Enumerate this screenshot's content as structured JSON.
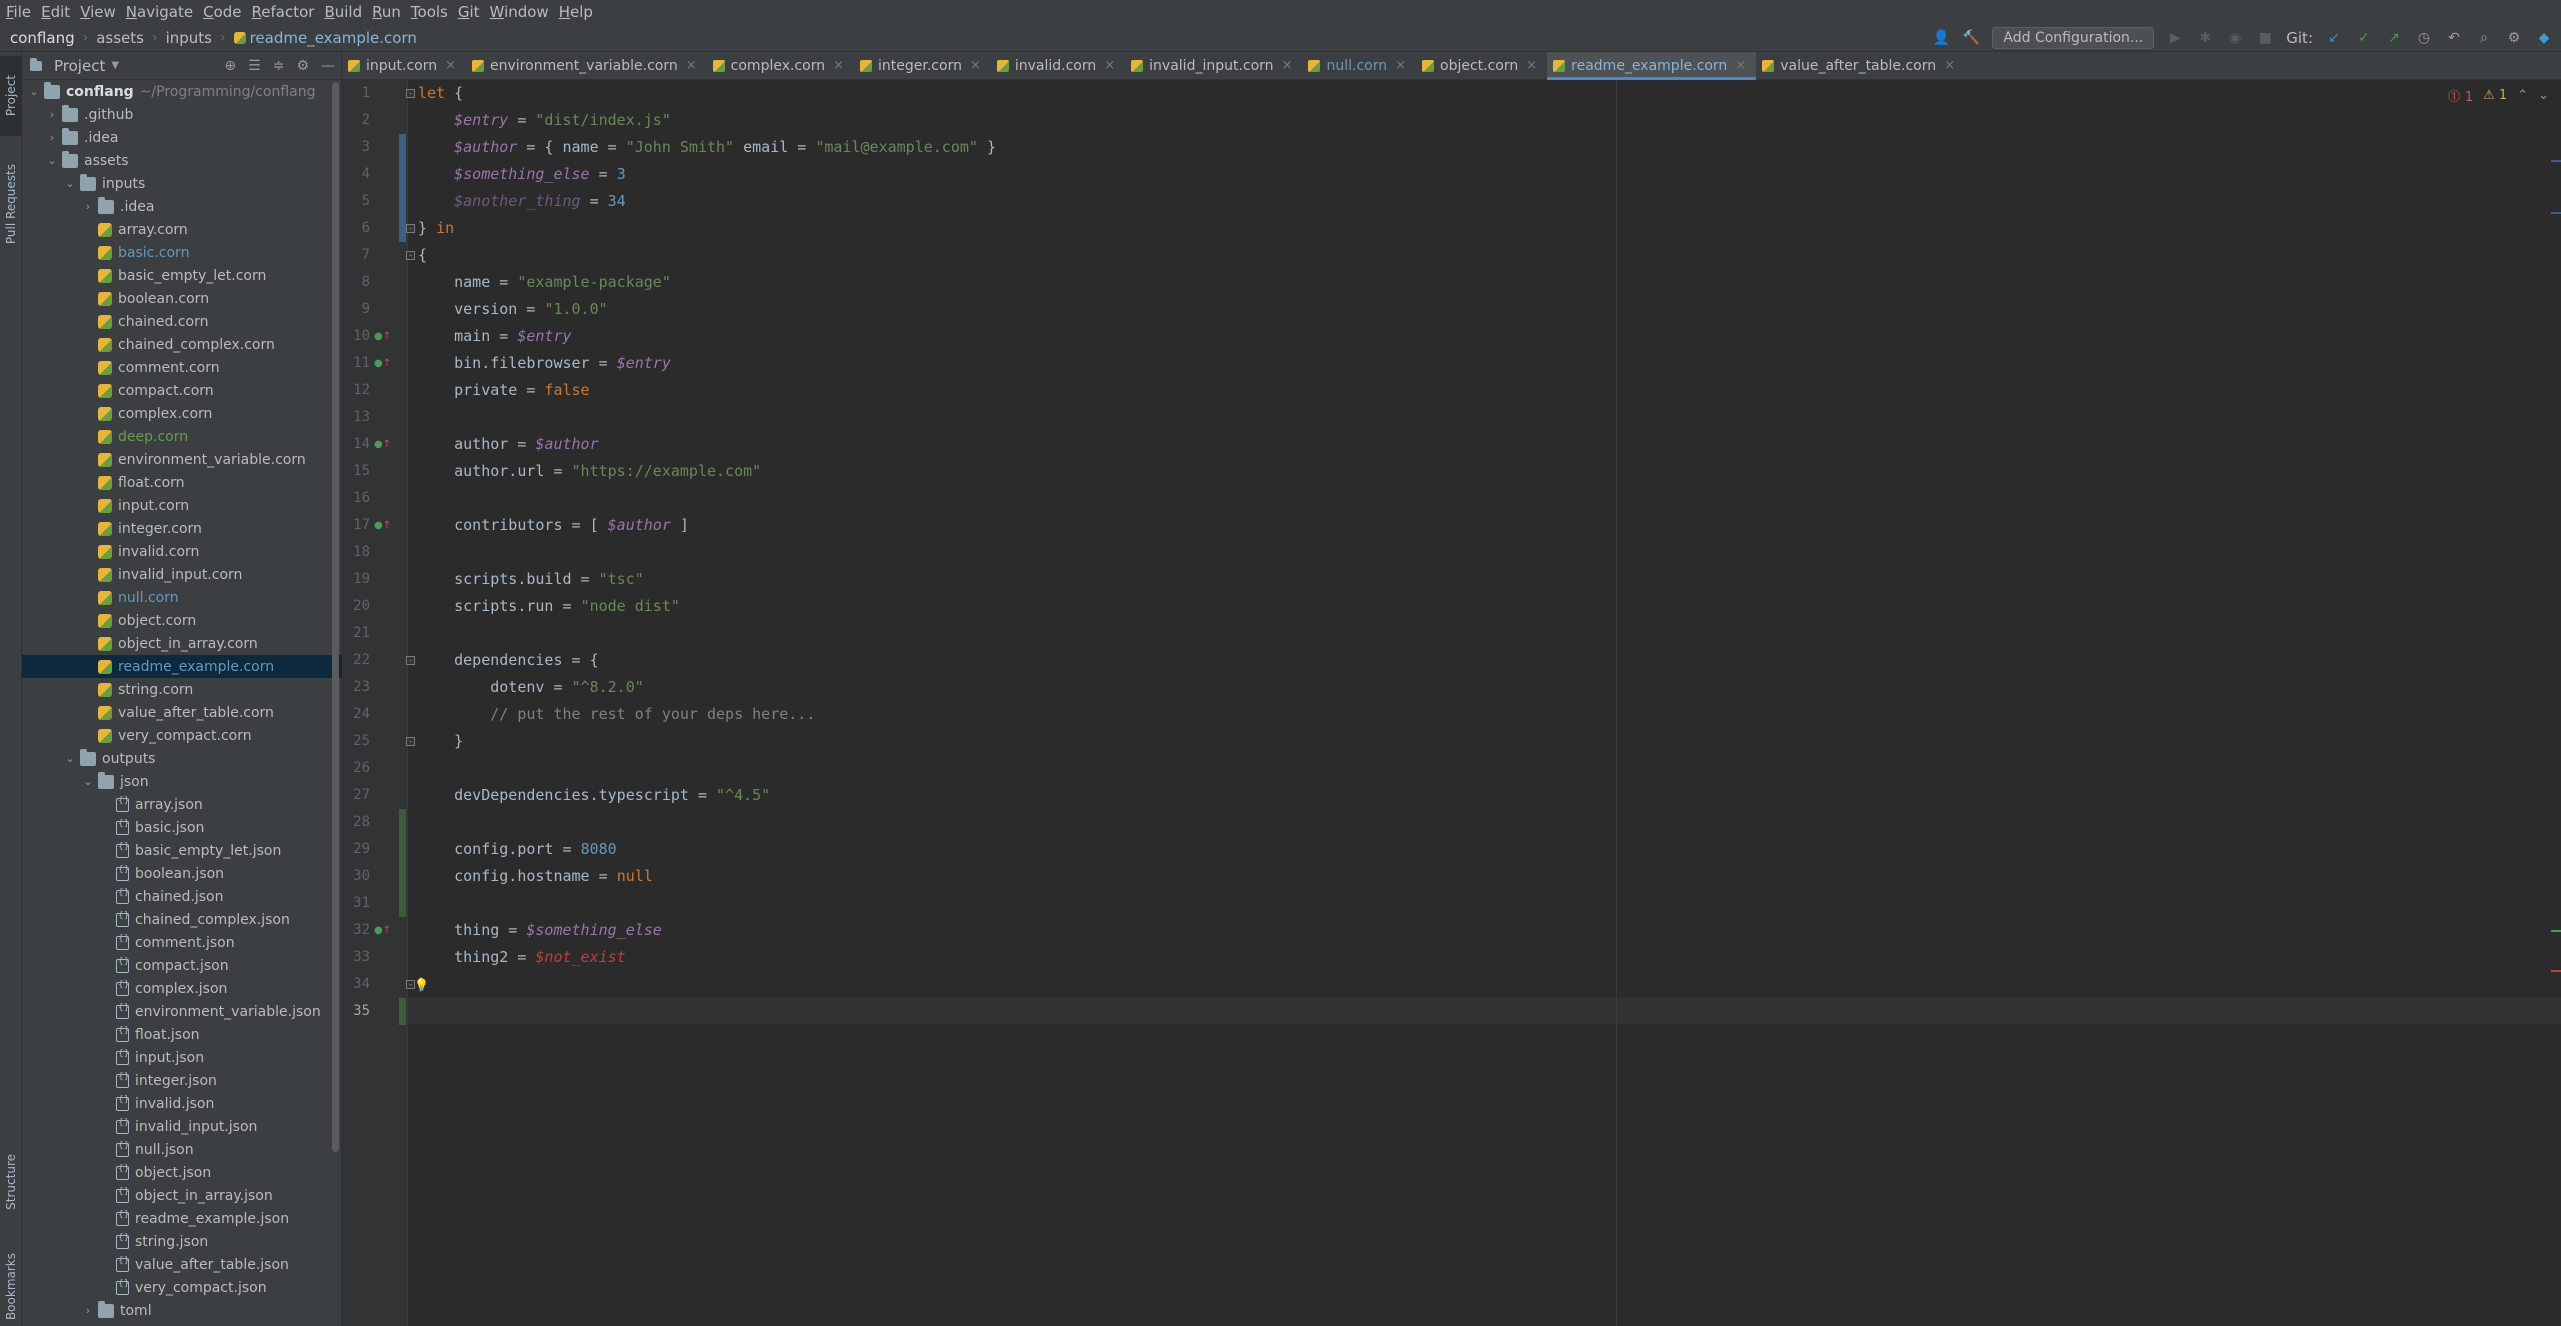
{
  "menu": [
    {
      "id": "file",
      "m": "F",
      "rest": "ile"
    },
    {
      "id": "edit",
      "m": "E",
      "rest": "dit"
    },
    {
      "id": "view",
      "m": "V",
      "rest": "iew"
    },
    {
      "id": "navigate",
      "m": "N",
      "rest": "avigate"
    },
    {
      "id": "code",
      "m": "C",
      "rest": "ode"
    },
    {
      "id": "refactor",
      "m": "R",
      "rest": "efactor"
    },
    {
      "id": "build",
      "m": "B",
      "rest": "uild"
    },
    {
      "id": "run",
      "m": "R",
      "rest": "un"
    },
    {
      "id": "tools",
      "m": "T",
      "rest": "ools"
    },
    {
      "id": "git",
      "m": "G",
      "rest": "it"
    },
    {
      "id": "window",
      "m": "W",
      "rest": "indow"
    },
    {
      "id": "help",
      "m": "H",
      "rest": "elp"
    }
  ],
  "breadcrumb": [
    "conflang",
    "assets",
    "inputs",
    "readme_example.corn"
  ],
  "toolbar": {
    "add_config": "Add Configuration...",
    "git_label": "Git:"
  },
  "left_strip": {
    "project": "Project",
    "pull_requests": "Pull Requests",
    "structure": "Structure",
    "bookmarks": "Bookmarks"
  },
  "project_panel": {
    "title": "Project",
    "tree": [
      {
        "depth": 0,
        "type": "folder",
        "open": true,
        "name": "conflang",
        "path": "~/Programming/conflang",
        "style": "root"
      },
      {
        "depth": 1,
        "type": "folder",
        "open": false,
        "name": ".github"
      },
      {
        "depth": 1,
        "type": "folder",
        "open": false,
        "name": ".idea"
      },
      {
        "depth": 1,
        "type": "folder",
        "open": true,
        "name": "assets"
      },
      {
        "depth": 2,
        "type": "folder",
        "open": true,
        "name": "inputs"
      },
      {
        "depth": 3,
        "type": "folder",
        "open": false,
        "name": ".idea"
      },
      {
        "depth": 3,
        "type": "corn",
        "name": "array.corn"
      },
      {
        "depth": 3,
        "type": "corn",
        "name": "basic.corn",
        "style": "blue"
      },
      {
        "depth": 3,
        "type": "corn",
        "name": "basic_empty_let.corn"
      },
      {
        "depth": 3,
        "type": "corn",
        "name": "boolean.corn"
      },
      {
        "depth": 3,
        "type": "corn",
        "name": "chained.corn"
      },
      {
        "depth": 3,
        "type": "corn",
        "name": "chained_complex.corn"
      },
      {
        "depth": 3,
        "type": "corn",
        "name": "comment.corn"
      },
      {
        "depth": 3,
        "type": "corn",
        "name": "compact.corn"
      },
      {
        "depth": 3,
        "type": "corn",
        "name": "complex.corn"
      },
      {
        "depth": 3,
        "type": "corn",
        "name": "deep.corn",
        "style": "green"
      },
      {
        "depth": 3,
        "type": "corn",
        "name": "environment_variable.corn"
      },
      {
        "depth": 3,
        "type": "corn",
        "name": "float.corn"
      },
      {
        "depth": 3,
        "type": "corn",
        "name": "input.corn"
      },
      {
        "depth": 3,
        "type": "corn",
        "name": "integer.corn"
      },
      {
        "depth": 3,
        "type": "corn",
        "name": "invalid.corn"
      },
      {
        "depth": 3,
        "type": "corn",
        "name": "invalid_input.corn"
      },
      {
        "depth": 3,
        "type": "corn",
        "name": "null.corn",
        "style": "blue"
      },
      {
        "depth": 3,
        "type": "corn",
        "name": "object.corn"
      },
      {
        "depth": 3,
        "type": "corn",
        "name": "object_in_array.corn"
      },
      {
        "depth": 3,
        "type": "corn",
        "name": "readme_example.corn",
        "style": "blue",
        "selected": true
      },
      {
        "depth": 3,
        "type": "corn",
        "name": "string.corn"
      },
      {
        "depth": 3,
        "type": "corn",
        "name": "value_after_table.corn"
      },
      {
        "depth": 3,
        "type": "corn",
        "name": "very_compact.corn"
      },
      {
        "depth": 2,
        "type": "folder",
        "open": true,
        "name": "outputs"
      },
      {
        "depth": 3,
        "type": "folder",
        "open": true,
        "name": "json"
      },
      {
        "depth": 4,
        "type": "json",
        "name": "array.json"
      },
      {
        "depth": 4,
        "type": "json",
        "name": "basic.json"
      },
      {
        "depth": 4,
        "type": "json",
        "name": "basic_empty_let.json"
      },
      {
        "depth": 4,
        "type": "json",
        "name": "boolean.json"
      },
      {
        "depth": 4,
        "type": "json",
        "name": "chained.json"
      },
      {
        "depth": 4,
        "type": "json",
        "name": "chained_complex.json"
      },
      {
        "depth": 4,
        "type": "json",
        "name": "comment.json"
      },
      {
        "depth": 4,
        "type": "json",
        "name": "compact.json"
      },
      {
        "depth": 4,
        "type": "json",
        "name": "complex.json"
      },
      {
        "depth": 4,
        "type": "json",
        "name": "environment_variable.json"
      },
      {
        "depth": 4,
        "type": "json",
        "name": "float.json"
      },
      {
        "depth": 4,
        "type": "json",
        "name": "input.json"
      },
      {
        "depth": 4,
        "type": "json",
        "name": "integer.json"
      },
      {
        "depth": 4,
        "type": "json",
        "name": "invalid.json"
      },
      {
        "depth": 4,
        "type": "json",
        "name": "invalid_input.json"
      },
      {
        "depth": 4,
        "type": "json",
        "name": "null.json"
      },
      {
        "depth": 4,
        "type": "json",
        "name": "object.json"
      },
      {
        "depth": 4,
        "type": "json",
        "name": "object_in_array.json"
      },
      {
        "depth": 4,
        "type": "json",
        "name": "readme_example.json"
      },
      {
        "depth": 4,
        "type": "json",
        "name": "string.json"
      },
      {
        "depth": 4,
        "type": "json",
        "name": "value_after_table.json"
      },
      {
        "depth": 4,
        "type": "json",
        "name": "very_compact.json"
      },
      {
        "depth": 3,
        "type": "folder",
        "open": false,
        "name": "toml"
      }
    ]
  },
  "tabs": [
    {
      "label": "input.corn"
    },
    {
      "label": "environment_variable.corn"
    },
    {
      "label": "complex.corn"
    },
    {
      "label": "integer.corn"
    },
    {
      "label": "invalid.corn"
    },
    {
      "label": "invalid_input.corn"
    },
    {
      "label": "null.corn",
      "style": "blue"
    },
    {
      "label": "object.corn"
    },
    {
      "label": "readme_example.corn",
      "active": true
    },
    {
      "label": "value_after_table.corn"
    }
  ],
  "inspections": {
    "errors": "1",
    "warnings": "1"
  },
  "current_line": 35,
  "code_lines": [
    [
      [
        "kw",
        "let"
      ],
      [
        "key",
        " {"
      ]
    ],
    [
      [
        "key",
        "    "
      ],
      [
        "var",
        "$entry"
      ],
      [
        "key",
        " = "
      ],
      [
        "str",
        "\"dist/index.js\""
      ]
    ],
    [
      [
        "key",
        "    "
      ],
      [
        "var",
        "$author"
      ],
      [
        "key",
        " = { name = "
      ],
      [
        "str",
        "\"John Smith\""
      ],
      [
        "key",
        " email = "
      ],
      [
        "str",
        "\"mail@example.com\""
      ],
      [
        "key",
        " }"
      ]
    ],
    [
      [
        "key",
        "    "
      ],
      [
        "var",
        "$something_else"
      ],
      [
        "key",
        " = "
      ],
      [
        "num",
        "3"
      ]
    ],
    [
      [
        "key",
        "    "
      ],
      [
        "var dim",
        "$another_thing"
      ],
      [
        "key",
        " = "
      ],
      [
        "num",
        "34"
      ]
    ],
    [
      [
        "key",
        "} "
      ],
      [
        "kw",
        "in"
      ]
    ],
    [
      [
        "key",
        "{"
      ]
    ],
    [
      [
        "key",
        "    name = "
      ],
      [
        "str",
        "\"example-package\""
      ]
    ],
    [
      [
        "key",
        "    version = "
      ],
      [
        "str",
        "\"1.0.0\""
      ]
    ],
    [
      [
        "key",
        "    main = "
      ],
      [
        "var",
        "$entry"
      ]
    ],
    [
      [
        "key",
        "    bin.filebrowser = "
      ],
      [
        "var",
        "$entry"
      ]
    ],
    [
      [
        "key",
        "    private = "
      ],
      [
        "kw",
        "false"
      ]
    ],
    [],
    [
      [
        "key",
        "    author = "
      ],
      [
        "var",
        "$author"
      ]
    ],
    [
      [
        "key",
        "    author.url = "
      ],
      [
        "str",
        "\"https://example.com\""
      ]
    ],
    [],
    [
      [
        "key",
        "    contributors = [ "
      ],
      [
        "var",
        "$author"
      ],
      [
        "key",
        " ]"
      ]
    ],
    [],
    [
      [
        "key",
        "    scripts.build = "
      ],
      [
        "str",
        "\"tsc\""
      ]
    ],
    [
      [
        "key",
        "    scripts.run = "
      ],
      [
        "str",
        "\"node dist\""
      ]
    ],
    [],
    [
      [
        "key",
        "    dependencies = {"
      ]
    ],
    [
      [
        "key",
        "        dotenv = "
      ],
      [
        "str",
        "\"^8.2.0\""
      ]
    ],
    [
      [
        "key",
        "        "
      ],
      [
        "cmt",
        "// put the rest of your deps here..."
      ]
    ],
    [
      [
        "key",
        "    }"
      ]
    ],
    [],
    [
      [
        "key",
        "    devDependencies.typescript = "
      ],
      [
        "str",
        "\"^4.5\""
      ]
    ],
    [],
    [
      [
        "key",
        "    config.port = "
      ],
      [
        "num",
        "8080"
      ]
    ],
    [
      [
        "key",
        "    config.hostname = "
      ],
      [
        "kw",
        "null"
      ]
    ],
    [],
    [
      [
        "key",
        "    thing = "
      ],
      [
        "var",
        "$something_else"
      ]
    ],
    [
      [
        "key",
        "    thing2 = "
      ],
      [
        "err",
        "$not_exist"
      ]
    ],
    [
      [
        "key",
        "}"
      ]
    ],
    []
  ],
  "gutter_marks": [
    10,
    11,
    14,
    17,
    32
  ],
  "folds": [
    1,
    6,
    7,
    22,
    25,
    34
  ],
  "colors": {
    "accent": "#4a88c7",
    "selection": "#0d293e",
    "keyword": "#cc7832",
    "string": "#6a8759",
    "number": "#6897bb",
    "variable": "#9876aa",
    "error": "#bc3f3c"
  }
}
